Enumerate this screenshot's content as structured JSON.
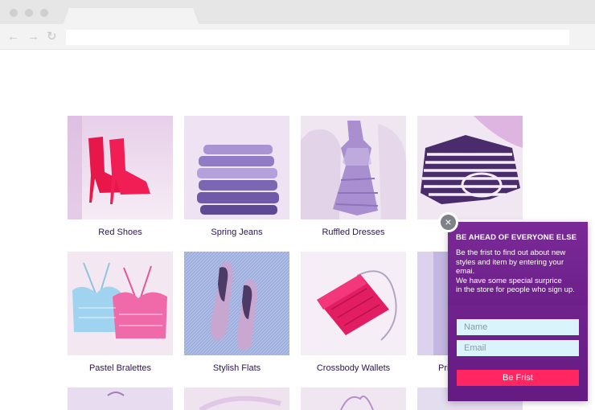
{
  "browser": {
    "back_icon": "←",
    "forward_icon": "→",
    "reload_icon": "↻"
  },
  "products": [
    {
      "label": "Red Shoes",
      "icon": "red-shoes"
    },
    {
      "label": "Spring Jeans",
      "icon": "jeans-stack"
    },
    {
      "label": "Ruffled Dresses",
      "icon": "dress"
    },
    {
      "label": "",
      "icon": "striped-shirt"
    },
    {
      "label": "Pastel Bralettes",
      "icon": "bralettes"
    },
    {
      "label": "Stylish Flats",
      "icon": "flats"
    },
    {
      "label": "Crossbody Wallets",
      "icon": "wallet"
    },
    {
      "label": "Pri",
      "icon": "print"
    }
  ],
  "popup": {
    "title": "BE AHEAD OF EVERYONE ELSE",
    "body_lines": [
      "Be the frist to find out about new",
      "styles and item by entering your",
      "emai.",
      "We have some special surprice",
      "in the store for people who sign up."
    ],
    "name_placeholder": "Name",
    "email_placeholder": "Email",
    "submit_label": "Be Frist",
    "close_icon": "×"
  }
}
